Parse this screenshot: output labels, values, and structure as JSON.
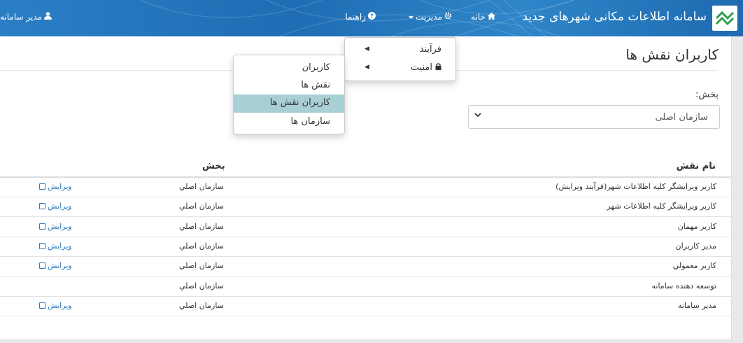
{
  "navbar": {
    "brand_title": "سامانه اطلاعات مکانی شهرهای جدید",
    "home_label": "خانه",
    "manage_label": "مدیریت",
    "help_label": "راهنما",
    "user_label": "مدیر سامانه"
  },
  "manage_menu": {
    "items": [
      {
        "label": "فرآیند"
      },
      {
        "label": "امنیت"
      }
    ]
  },
  "security_menu": {
    "items": [
      {
        "label": "کاربران"
      },
      {
        "label": "نقش ها"
      },
      {
        "label": "کاربران نقش ها",
        "active": true
      },
      {
        "label": "سازمان ها"
      }
    ]
  },
  "page": {
    "title": "کاربران نقش ها",
    "section_label": "بخش:",
    "section_value": "سازمان اصلی"
  },
  "table": {
    "headers": {
      "role": "نام نقش",
      "section": "بخش"
    },
    "edit_label": "ویرایش",
    "rows": [
      {
        "role": "کاربر ویرایشگر کلیه اطلاعات شهر(فرآیند ویرایش)",
        "section": "سازمان اصلي",
        "editable": true
      },
      {
        "role": "کاربر ویرایشگر کلیه اطلاعات شهر",
        "section": "سازمان اصلي",
        "editable": true
      },
      {
        "role": "کاربر مهمان",
        "section": "سازمان اصلي",
        "editable": true
      },
      {
        "role": "مدير كاربران",
        "section": "سازمان اصلي",
        "editable": true
      },
      {
        "role": "كاربر معمولي",
        "section": "سازمان اصلي",
        "editable": true
      },
      {
        "role": "توسعه دهنده سامانه",
        "section": "سازمان اصلي",
        "editable": false
      },
      {
        "role": "مدير سامانه",
        "section": "سازمان اصلي",
        "editable": true
      }
    ]
  },
  "colors": {
    "navbar": "#2a7fc4",
    "active_menu": "#a8cfd3",
    "link": "#337ab7",
    "logo_green": "#2e9e4f"
  },
  "icons": {
    "home": "home-icon",
    "manage": "gear-icon",
    "help": "question-circle-icon",
    "user": "user-icon",
    "lock": "lock-icon",
    "edit": "edit-icon",
    "caret": "caret-left-icon",
    "select_arrow": "chevron-down-icon"
  }
}
